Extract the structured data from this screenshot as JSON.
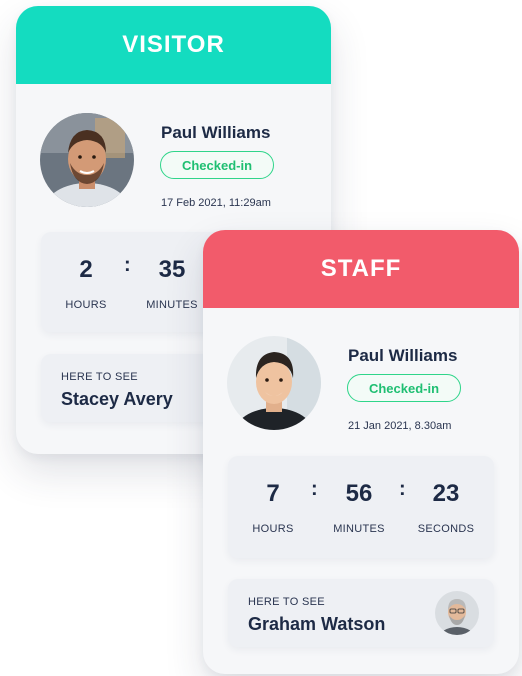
{
  "visitor_card": {
    "header": "VISITOR",
    "name": "Paul Williams",
    "status": "Checked-in",
    "timestamp": "17 Feb 2021, 11:29am",
    "timer": {
      "hours_value": "2",
      "hours_label": "HOURS",
      "minutes_value": "35",
      "minutes_label": "MINUTES",
      "separator": ":"
    },
    "host": {
      "label": "HERE TO SEE",
      "name": "Stacey Avery"
    }
  },
  "staff_card": {
    "header": "STAFF",
    "name": "Paul Williams",
    "status": "Checked-in",
    "timestamp": "21 Jan 2021, 8.30am",
    "timer": {
      "hours_value": "7",
      "hours_label": "HOURS",
      "minutes_value": "56",
      "minutes_label": "MINUTES",
      "seconds_value": "23",
      "seconds_label": "SECONDS",
      "separator": ":"
    },
    "host": {
      "label": "HERE TO SEE",
      "name": "Graham Watson"
    }
  },
  "colors": {
    "visitor_accent": "#14dcc0",
    "staff_accent": "#f25b6b",
    "checked_in_green": "#2fd58a",
    "text_dark": "#1d2a45",
    "card_bg": "#f6f7f9"
  },
  "icons": {
    "visitor_avatar": "person-photo-avatar",
    "staff_avatar": "person-photo-avatar",
    "host_avatar": "person-photo-avatar"
  }
}
